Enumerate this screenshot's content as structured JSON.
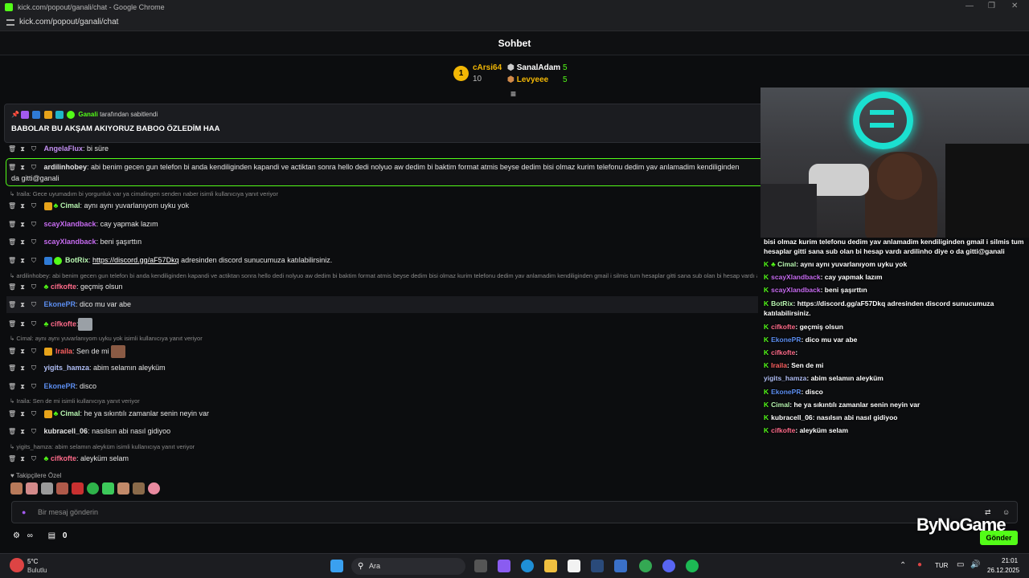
{
  "window": {
    "title": "kick.com/popout/ganali/chat - Google Chrome",
    "url": "kick.com/popout/ganali/chat"
  },
  "chat": {
    "header": "Sohbet",
    "leaderboard": [
      {
        "rank": "1",
        "name": "cArsi64",
        "count": "10"
      },
      {
        "name": "SanalAdam",
        "count": "5"
      },
      {
        "name": "Levyeee",
        "count": "5"
      }
    ],
    "pinned": {
      "by_user": "Ganali",
      "by_text": "tarafından sabitlendi",
      "message": "BABOLAR BU AKŞAM AKIYORUZ BABOO ÖZLEDİM HAA"
    },
    "messages": [
      {
        "user": "AngelaFlux",
        "color": "#c38ff2",
        "text": ": bi süre"
      },
      {
        "user": "ardilinhobey",
        "color": "#e6e6e6",
        "text": ": abi benim gecen gun telefon bi anda kendiliginden kapandi ve actiktan sonra hello dedi nolyuo aw dedim bi baktim format atmis beyse dedim bisi olmaz kurim telefonu dedim yav anlamadim kendiliginden",
        "text2": "da gitti@ganali"
      },
      {
        "reply": "Iraila: Gece uyumadım bi yorgunluk var ya cimalingen senden naber isimli kullanıcıya yanıt veriyor"
      },
      {
        "user": "Cimal",
        "color": "#b7f5b0",
        "text": ": aynı aynı yuvarlanıyom uyku yok"
      },
      {
        "user": "scayXlandback",
        "color": "#c66bf0",
        "text": ": cay yapmak lazım"
      },
      {
        "user": "scayXlandback",
        "color": "#c66bf0",
        "text": ": beni şaşırttın"
      },
      {
        "user": "BotRix",
        "color": "#b7f5b0",
        "text_link": "https://discord.gg/aF57Dkq",
        "text": " adresinden discord sunucumuza katılabilirsiniz."
      },
      {
        "reply": "ardilinhobey: abi benim gecen gun telefon bi anda kendiliginden kapandi ve actiktan sonra hello dedi nolyuo aw dedim bi baktim format atmis beyse dedim bisi olmaz kurim telefonu dedim yav anlamadim kendiliginden gmail i silmis tum hesaplar gitti sana sub olan bi hesap vardı ardilinho diye o da gitti@ganali isimli kullanıcı..."
      },
      {
        "user": "cifkofte",
        "color": "#ff6b8a",
        "text": ": geçmiş olsun"
      },
      {
        "user": "EkonePR",
        "color": "#5b8def",
        "text": ": dico mu var abe"
      },
      {
        "user": "cifkofte",
        "color": "#ff6b8a",
        "text": ":"
      },
      {
        "reply": "Cimal: aynı aynı yuvarlanıyom uyku yok isimli kullanıcıya yanıt veriyor"
      },
      {
        "user": "Iraila",
        "color": "#ff6161",
        "text": ": Sen de mi"
      },
      {
        "user": "yigits_hamza",
        "color": "#b0bef5",
        "text": ": abim selamın aleyküm"
      },
      {
        "user": "EkonePR",
        "color": "#5b8def",
        "text": ": disco"
      },
      {
        "reply": "Iraila: Sen de mi isimli kullanıcıya yanıt veriyor"
      },
      {
        "user": "Cimal",
        "color": "#b7f5b0",
        "text": ": he ya sıkıntılı zamanlar senin neyin var"
      },
      {
        "user": "kubracell_06",
        "color": "#e6e6e6",
        "text": ": nasılsın abi nasıl gidiyoo"
      },
      {
        "reply": "yigits_hamza: abim selamın aleyküm isimli kullanıcıya yanıt veriyor"
      },
      {
        "user": "cifkofte",
        "color": "#ff6b8a",
        "text": ": aleyküm selam"
      }
    ],
    "emote_section_label": "Takipçilere Özel",
    "input_placeholder": "Bir mesaj gönderin",
    "points": "0",
    "send_label": "Gönder"
  },
  "overlay": {
    "lines": [
      {
        "text": "bisi olmaz kurim telefonu dedim yav anlamadim kendiliginden gmail i silmis tum"
      },
      {
        "text": "hesaplar gitti sana sub olan bi hesap vardı ardilinho diye o da gitti@ganali"
      },
      {
        "user": "Cimal",
        "color": "#b7f5b0",
        "text": ": aynı aynı yuvarlanıyom uyku yok"
      },
      {
        "user": "scayXlandback",
        "color": "#c66bf0",
        "text": ": cay yapmak lazım"
      },
      {
        "user": "scayXlandback",
        "color": "#c66bf0",
        "text": ": beni şaşırttın"
      },
      {
        "user": "BotRix",
        "color": "#b7f5b0",
        "text": ": https://discord.gg/aF57Dkq adresinden discord sunucumuza"
      },
      {
        "text": "katılabilirsiniz."
      },
      {
        "user": "cifkofte",
        "color": "#ff6b8a",
        "text": ": geçmiş olsun"
      },
      {
        "user": "EkonePR",
        "color": "#5b8def",
        "text": ": dico mu var abe"
      },
      {
        "user": "cifkofte",
        "color": "#ff6b8a",
        "text": ":"
      },
      {
        "user": "Iraila",
        "color": "#ff6161",
        "text": ": Sen de mi"
      },
      {
        "user": "yigits_hamza",
        "color": "#b0bef5",
        "text": ": abim selamın aleyküm"
      },
      {
        "user": "EkonePR",
        "color": "#5b8def",
        "text": ": disco"
      },
      {
        "user": "Cimal",
        "color": "#b7f5b0",
        "text": ": he ya sıkıntılı zamanlar senin neyin var"
      },
      {
        "user": "kubracell_06",
        "color": "#e6e6e6",
        "text": ": nasılsın abi nasıl gidiyoo"
      },
      {
        "user": "cifkofte",
        "color": "#ff6b8a",
        "text": ": aleyküm selam"
      }
    ],
    "brand": "ByNoGame"
  },
  "taskbar": {
    "weather_temp": "5°C",
    "weather_desc": "Bulutlu",
    "search_label": "Ara",
    "lang": "TUR",
    "time": "21:01",
    "date": "26.12.2025"
  }
}
